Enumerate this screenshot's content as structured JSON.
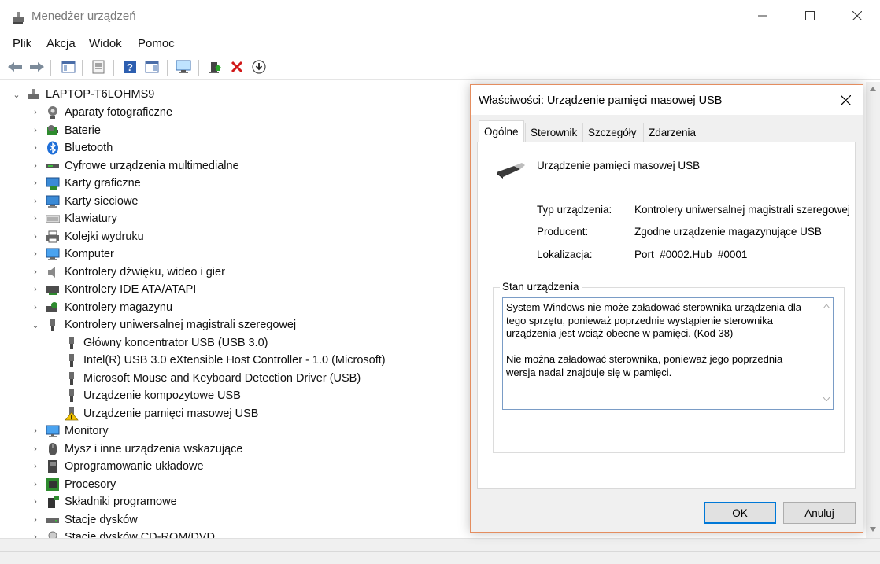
{
  "window": {
    "title": "Menedżer urządzeń"
  },
  "menu": [
    "Plik",
    "Akcja",
    "Widok",
    "Pomoc"
  ],
  "tree": {
    "root": "LAPTOP-T6LOHMS9",
    "categories": [
      "Aparaty fotograficzne",
      "Baterie",
      "Bluetooth",
      "Cyfrowe urządzenia multimedialne",
      "Karty graficzne",
      "Karty sieciowe",
      "Klawiatury",
      "Kolejki wydruku",
      "Komputer",
      "Kontrolery dźwięku, wideo i gier",
      "Kontrolery IDE ATA/ATAPI",
      "Kontrolery magazynu",
      "Kontrolery uniwersalnej magistrali szeregowej"
    ],
    "usb_children": [
      "Główny koncentrator USB (USB 3.0)",
      "Intel(R) USB 3.0 eXtensible Host Controller - 1.0 (Microsoft)",
      "Microsoft Mouse and Keyboard Detection Driver (USB)",
      "Urządzenie kompozytowe USB",
      "Urządzenie pamięci masowej USB"
    ],
    "categories_after": [
      "Monitory",
      "Mysz i inne urządzenia wskazujące",
      "Oprogramowanie układowe",
      "Procesory",
      "Składniki programowe",
      "Stacje dysków",
      "Stacje dysków CD-ROM/DVD"
    ]
  },
  "dialog": {
    "title": "Właściwości: Urządzenie pamięci masowej USB",
    "tabs": [
      "Ogólne",
      "Sterownik",
      "Szczegóły",
      "Zdarzenia"
    ],
    "device_name": "Urządzenie pamięci masowej USB",
    "props": {
      "type_label": "Typ urządzenia:",
      "type_value": "Kontrolery uniwersalnej magistrali szeregowej",
      "manufacturer_label": "Producent:",
      "manufacturer_value": "Zgodne urządzenie magazynujące USB",
      "location_label": "Lokalizacja:",
      "location_value": "Port_#0002.Hub_#0001"
    },
    "status_label": "Stan urządzenia",
    "status_text": "System Windows nie może załadować sterownika urządzenia dla\ntego sprzętu, ponieważ poprzednie wystąpienie sterownika\nurządzenia jest wciąż obecne w pamięci. (Kod 38)\n\nNie można załadować sterownika, ponieważ jego poprzednia\nwersja nadal znajduje się w pamięci.",
    "ok": "OK",
    "cancel": "Anuluj"
  }
}
